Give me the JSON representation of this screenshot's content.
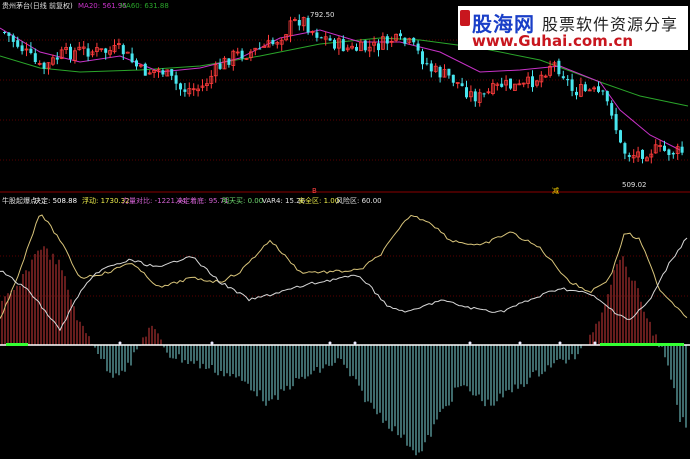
{
  "colors": {
    "background": "#000000",
    "candle_up": "#ff3b3b",
    "candle_down": "#48e5ee",
    "ma20": "#c832c8",
    "ma60": "#2aa52a",
    "grid": "#5a0000",
    "osc_yellow": "#d8c47a",
    "osc_white": "#d8d8d8",
    "hist_red": "#cc3a3a",
    "hist_cyan": "#7bd3d6",
    "signal_green": "#33ff33"
  },
  "main_panel": {
    "title": "贵州茅台(日线 前复权)",
    "ma20_label": "MA20: 561.95",
    "ma60_label": "MA60: 631.88",
    "high_label": "792.50",
    "low_label": "509.02",
    "marker_buy": "减",
    "marker_sell": "B"
  },
  "indicator_panel": {
    "title": "牛股起爆点",
    "items": [
      {
        "label": "决定: 508.88",
        "color": "#ffffff"
      },
      {
        "label": "浮动: 1730.32",
        "color": "#e8e84a"
      },
      {
        "label": "力量对比: -1221.44",
        "color": "#d060d0"
      },
      {
        "label": "决定着底: 95.71",
        "color": "#d060d0"
      },
      {
        "label": "明天买: 0.00",
        "color": "#6fd86f"
      },
      {
        "label": "VAR4: 15.26",
        "color": "#e0e0e0"
      },
      {
        "label": "安全区: 1.00",
        "color": "#e8e84a"
      },
      {
        "label": "风险区: 60.00",
        "color": "#e0e0e0"
      }
    ]
  },
  "banner": {
    "brand": "股海网",
    "slogan": "股票软件资源分享",
    "url": "www.Guhai.com.cn"
  }
}
